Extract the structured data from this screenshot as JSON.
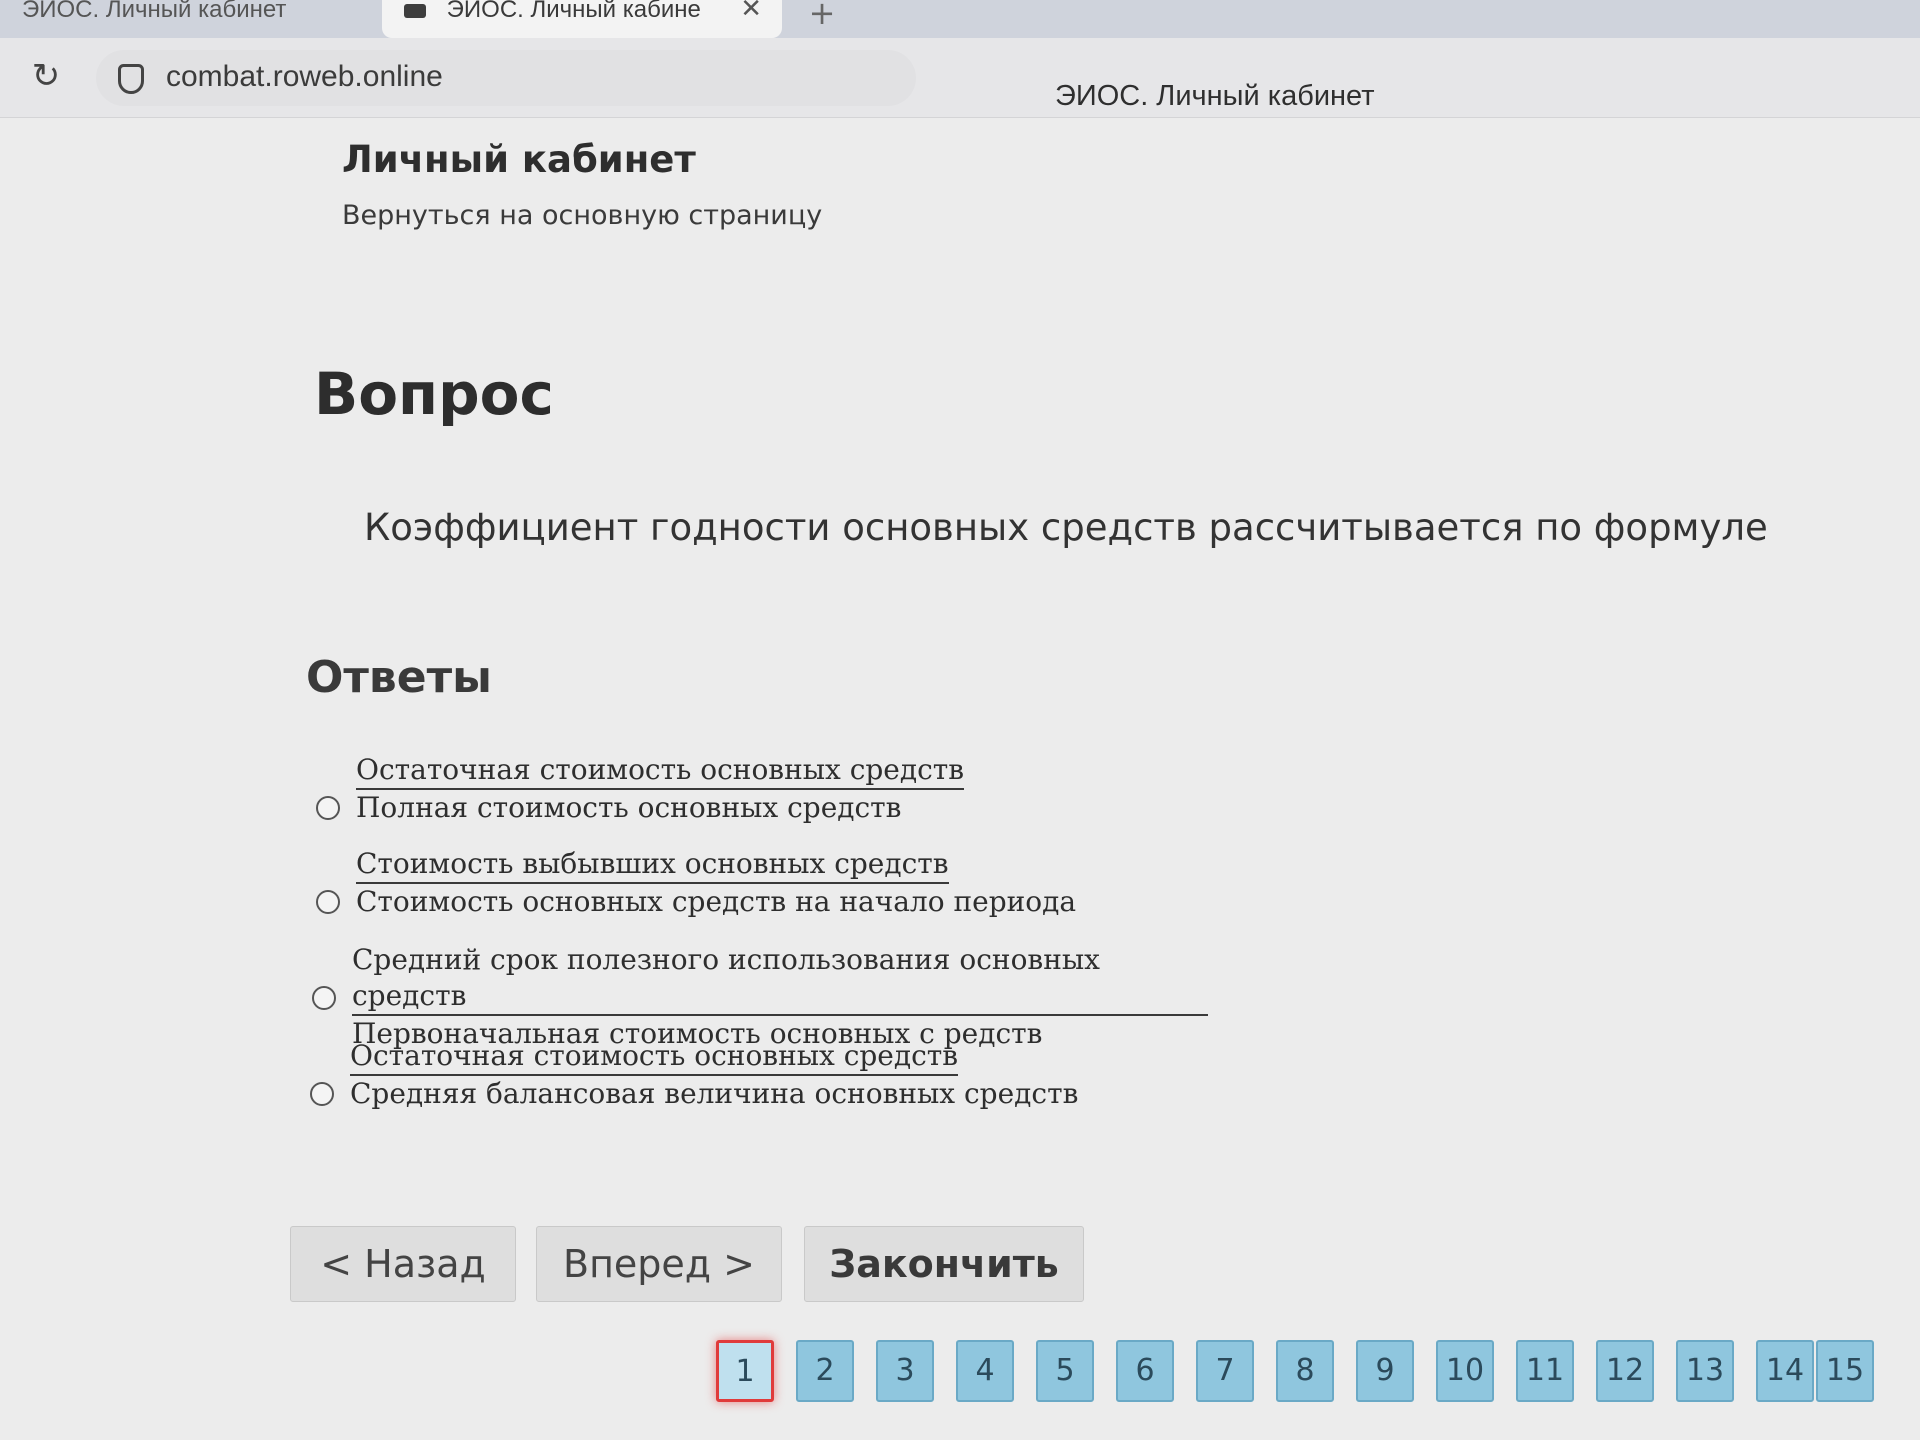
{
  "browser": {
    "tabs": [
      {
        "label": "ЭИОС. Личный кабинет",
        "active": false
      },
      {
        "label": "ЭИОС. Личный кабине",
        "active": true
      }
    ],
    "url": "combat.roweb.online",
    "window_title": "ЭИОС. Личный кабинет"
  },
  "header": {
    "title": "Личный кабинет",
    "back_link": "Вернуться на основную страницу"
  },
  "question": {
    "heading": "Вопрос",
    "text": "Коэффициент годности основных средств рассчитывается по формуле"
  },
  "answers": {
    "heading": "Ответы",
    "options": [
      {
        "numerator": "Остаточная стоимость основных средств",
        "denominator": "Полная стоимость основных средств",
        "selected": false
      },
      {
        "numerator": "Стоимость выбывших основных средств",
        "denominator": "Стоимость основных средств на начало периода",
        "selected": false
      },
      {
        "numerator": "Средний срок полезного использования основных средств",
        "denominator": "Первоначальная стоимость основных с редств",
        "selected": false
      },
      {
        "numerator": "Остаточная стоимость основных средств",
        "denominator": "Средняя балансовая величина основных средств",
        "selected": false
      }
    ]
  },
  "buttons": {
    "back": "< Назад",
    "forward": "Вперед >",
    "finish": "Закончить"
  },
  "pagination": {
    "current": "1",
    "pages": [
      "1",
      "2",
      "3",
      "4",
      "5",
      "6",
      "7",
      "8",
      "9",
      "10",
      "11",
      "12",
      "13",
      "14",
      "15"
    ]
  },
  "colors": {
    "page_button": "#8fc6de",
    "current_page_border": "#e03b3b"
  }
}
